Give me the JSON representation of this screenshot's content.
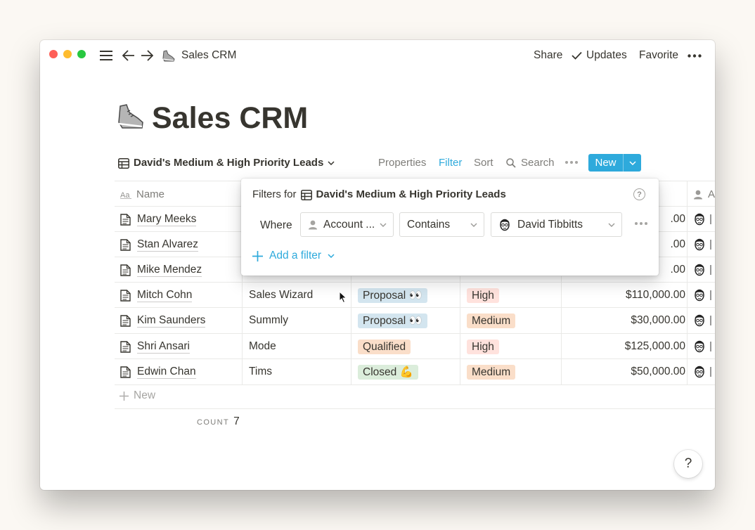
{
  "window": {
    "breadcrumb_title": "Sales CRM",
    "breadcrumb_icon": "sneaker-icon",
    "share_label": "Share",
    "updates_label": "Updates",
    "favorite_label": "Favorite"
  },
  "page": {
    "title": "Sales CRM",
    "icon": "sneaker-icon"
  },
  "view": {
    "name": "David's Medium & High Priority Leads",
    "properties_label": "Properties",
    "filter_label": "Filter",
    "sort_label": "Sort",
    "search_label": "Search",
    "new_label": "New"
  },
  "table": {
    "name_header": "Name",
    "owner_header_partial": "A",
    "rows": [
      {
        "name": "Mary Meeks",
        "company": "",
        "status": "",
        "priority": "",
        "amount": ".00"
      },
      {
        "name": "Stan Alvarez",
        "company": "",
        "status": "",
        "priority": "",
        "amount": ".00"
      },
      {
        "name": "Mike Mendez",
        "company": "",
        "status": "",
        "priority": "",
        "amount": ".00"
      },
      {
        "name": "Mitch Cohn",
        "company": "Sales Wizard",
        "status": "Proposal 👀",
        "priority": "High",
        "amount": "$110,000.00"
      },
      {
        "name": "Kim Saunders",
        "company": "Summly",
        "status": "Proposal 👀",
        "priority": "Medium",
        "amount": "$30,000.00"
      },
      {
        "name": "Shri Ansari",
        "company": "Mode",
        "status": "Qualified",
        "priority": "High",
        "amount": "$125,000.00"
      },
      {
        "name": "Edwin Chan",
        "company": "Tims",
        "status": "Closed 💪",
        "priority": "Medium",
        "amount": "$50,000.00"
      }
    ],
    "new_row_label": "New",
    "count_label": "COUNT",
    "count_value": "7"
  },
  "filter_popup": {
    "title_prefix": "Filters for",
    "title_view": "David's Medium & High Priority Leads",
    "where_label": "Where",
    "property": "Account ...",
    "operator": "Contains",
    "value": "David Tibbitts",
    "add_filter_label": "Add a filter"
  },
  "help_label": "?",
  "colors": {
    "accent": "#2eaadc",
    "tag_blue": "#d3e5ef",
    "tag_orange": "#fadec9",
    "tag_red": "#ffe2dd",
    "tag_green": "#dbeddb"
  }
}
